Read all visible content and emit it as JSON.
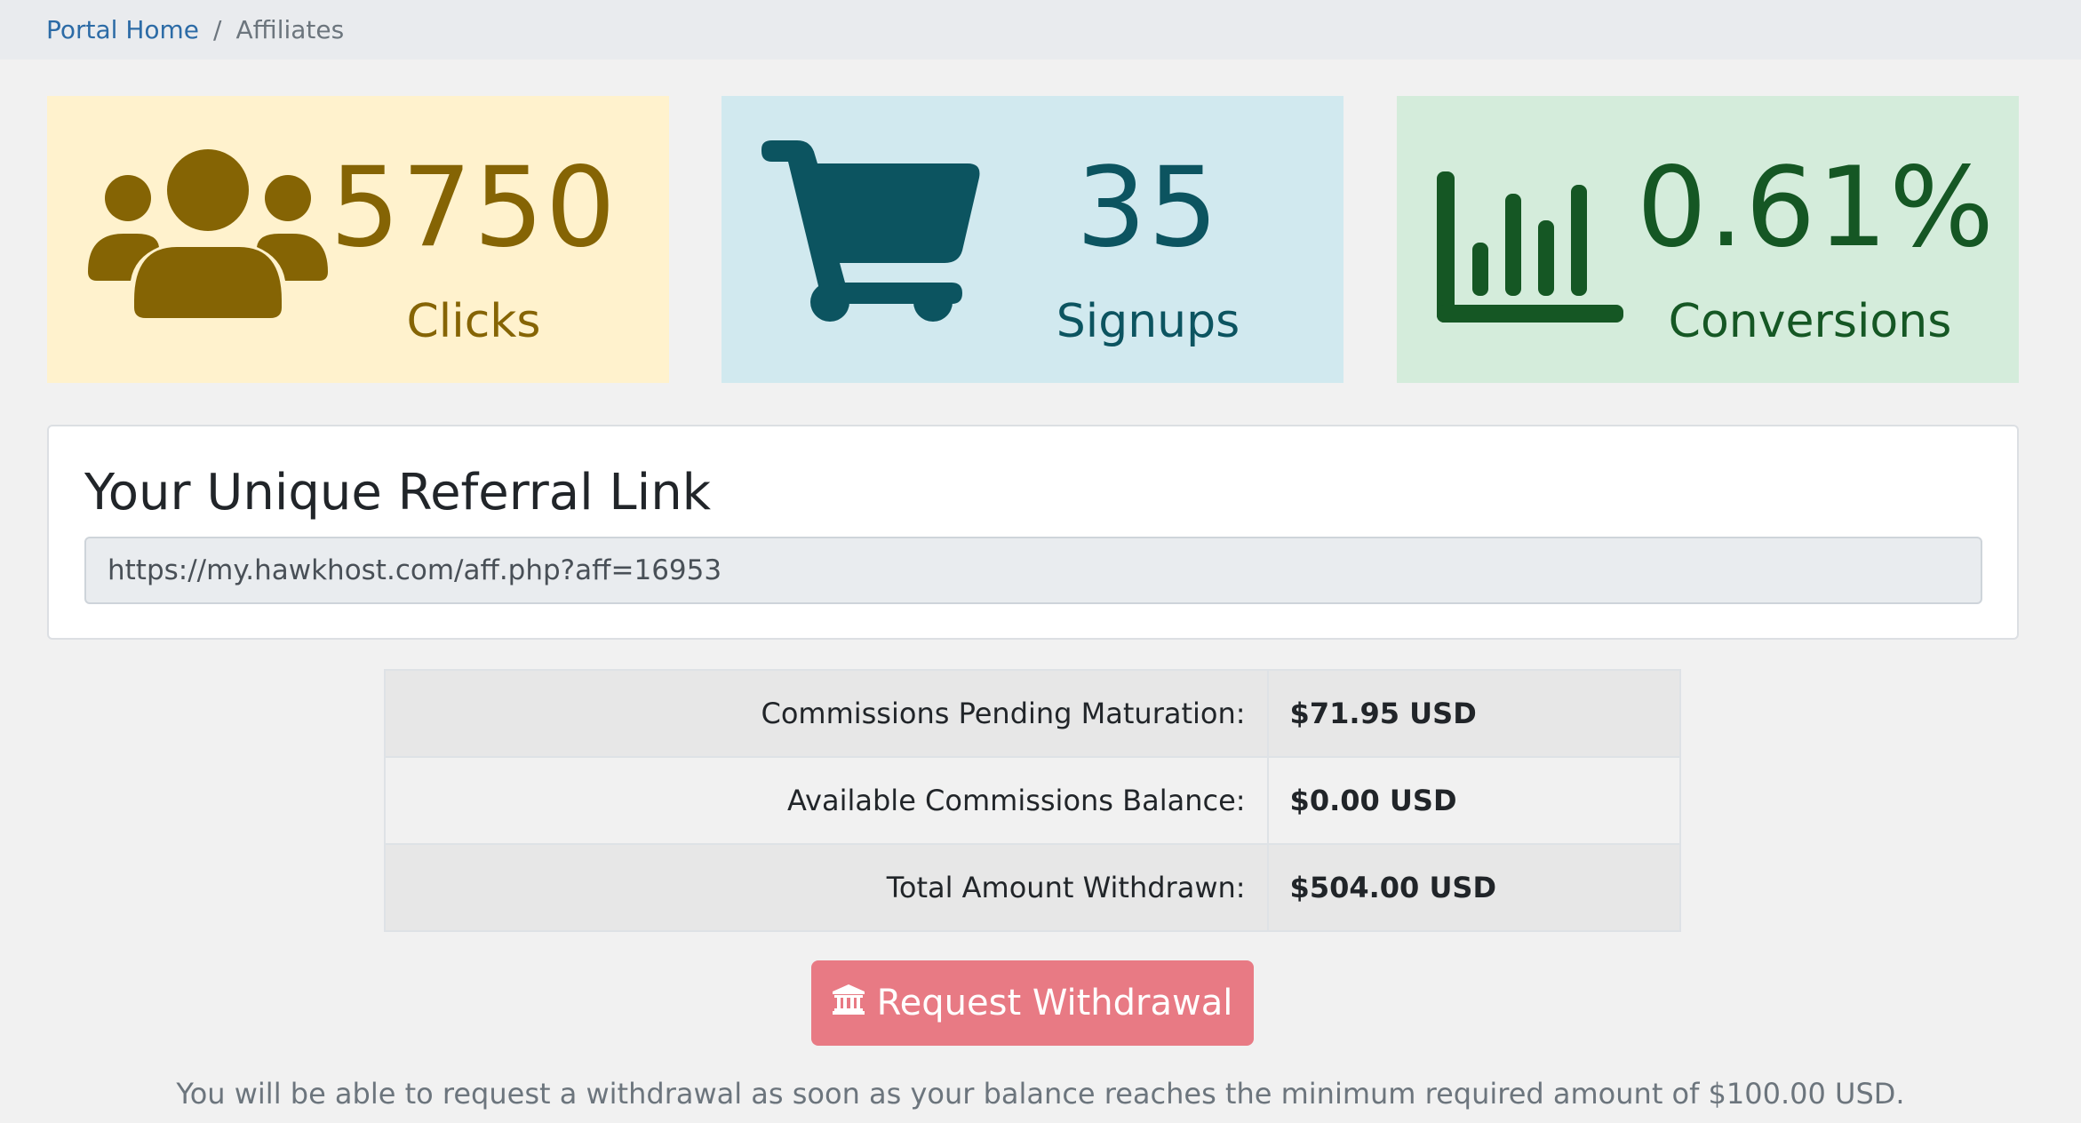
{
  "breadcrumb": {
    "home_label": "Portal Home",
    "separator": "/",
    "current_label": "Affiliates"
  },
  "stats": {
    "clicks": {
      "value": "5750",
      "label": "Clicks",
      "icon": "users-icon",
      "color": "#856404",
      "background": "#fff2cd"
    },
    "signups": {
      "value": "35",
      "label": "Signups",
      "icon": "shopping-cart-icon",
      "color": "#0c5460",
      "background": "#d1e9ef"
    },
    "conversions": {
      "value": "0.61%",
      "label": "Conversions",
      "icon": "bar-chart-icon",
      "color": "#155724",
      "background": "#d4ecdb"
    }
  },
  "referral": {
    "title": "Your Unique Referral Link",
    "link": "https://my.hawkhost.com/aff.php?aff=16953"
  },
  "commissions": {
    "rows": [
      {
        "label": "Commissions Pending Maturation:",
        "value": "$71.95 USD"
      },
      {
        "label": "Available Commissions Balance:",
        "value": "$0.00 USD"
      },
      {
        "label": "Total Amount Withdrawn:",
        "value": "$504.00 USD"
      }
    ]
  },
  "withdraw": {
    "button_label": "Request Withdrawal",
    "button_icon": "bank-icon",
    "button_color": "#e87a84",
    "note": "You will be able to request a withdrawal as soon as your balance reaches the minimum required amount of $100.00 USD."
  }
}
